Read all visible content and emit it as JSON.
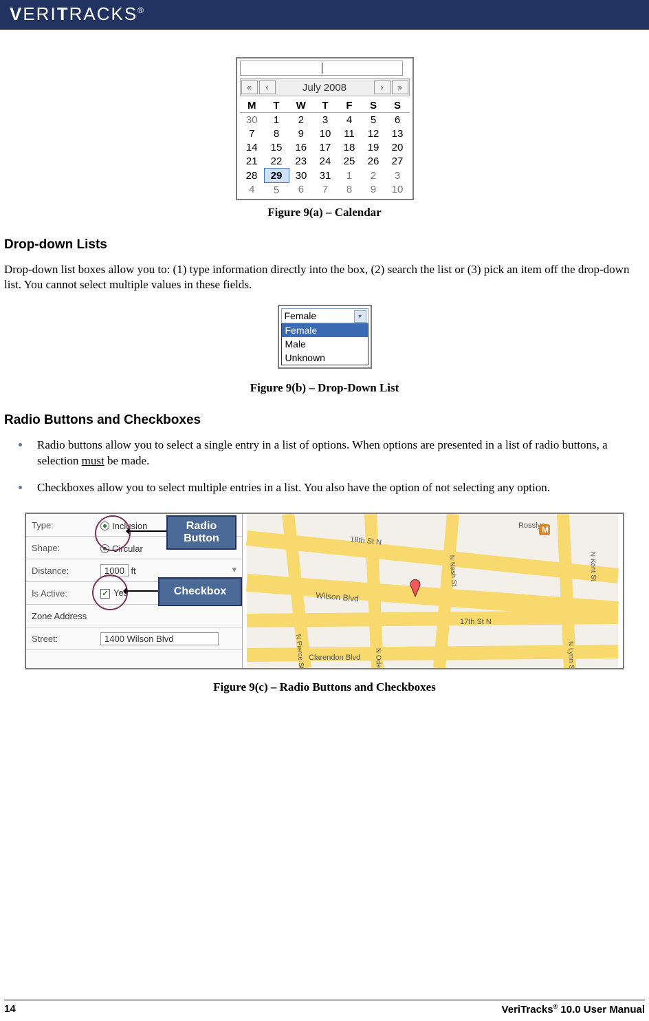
{
  "brand": "VERITRACKS",
  "regmark": "®",
  "figA_caption": "Figure 9(a) – Calendar",
  "calendar": {
    "title": "July 2008",
    "nav_first": "«",
    "nav_prev": "‹",
    "nav_next": "›",
    "nav_last": "»",
    "dow": [
      "M",
      "T",
      "W",
      "T",
      "F",
      "S",
      "S"
    ],
    "rows": [
      [
        {
          "d": "30",
          "dim": true
        },
        {
          "d": "1"
        },
        {
          "d": "2"
        },
        {
          "d": "3"
        },
        {
          "d": "4"
        },
        {
          "d": "5"
        },
        {
          "d": "6"
        }
      ],
      [
        {
          "d": "7"
        },
        {
          "d": "8"
        },
        {
          "d": "9"
        },
        {
          "d": "10"
        },
        {
          "d": "11"
        },
        {
          "d": "12"
        },
        {
          "d": "13"
        }
      ],
      [
        {
          "d": "14"
        },
        {
          "d": "15"
        },
        {
          "d": "16"
        },
        {
          "d": "17"
        },
        {
          "d": "18"
        },
        {
          "d": "19"
        },
        {
          "d": "20"
        }
      ],
      [
        {
          "d": "21"
        },
        {
          "d": "22"
        },
        {
          "d": "23"
        },
        {
          "d": "24"
        },
        {
          "d": "25"
        },
        {
          "d": "26"
        },
        {
          "d": "27"
        }
      ],
      [
        {
          "d": "28"
        },
        {
          "d": "29",
          "sel": true
        },
        {
          "d": "30"
        },
        {
          "d": "31"
        },
        {
          "d": "1",
          "dim": true
        },
        {
          "d": "2",
          "dim": true
        },
        {
          "d": "3",
          "dim": true
        }
      ],
      [
        {
          "d": "4",
          "dim": true
        },
        {
          "d": "5",
          "dim": true
        },
        {
          "d": "6",
          "dim": true
        },
        {
          "d": "7",
          "dim": true
        },
        {
          "d": "8",
          "dim": true
        },
        {
          "d": "9",
          "dim": true
        },
        {
          "d": "10",
          "dim": true
        }
      ]
    ]
  },
  "sec1_heading": "Drop-down Lists",
  "sec1_para": "Drop-down list boxes allow you to: (1) type information directly into the box, (2) search the list or (3) pick an item off the drop-down list. You cannot select multiple values in these fields.",
  "dropdown": {
    "value": "Female",
    "options": [
      "Female",
      "Male",
      "Unknown"
    ]
  },
  "figB_caption": "Figure 9(b) – Drop-Down List",
  "sec2_heading": "Radio Buttons and Checkboxes",
  "bullet1_a": "Radio buttons allow you to select a single entry in a list of options. When options are presented in a list of radio buttons, a selection ",
  "bullet1_u": "must",
  "bullet1_b": " be made.",
  "bullet2": "Checkboxes allow you to select multiple entries in a list. You also have the option of not selecting any option.",
  "form": {
    "labels": {
      "type": "Type:",
      "shape": "Shape:",
      "distance": "Distance:",
      "isactive": "Is Active:",
      "zone": "Zone Address",
      "street": "Street:"
    },
    "type_inclusion": "Inclusion",
    "shape_circular": "Circular",
    "distance_val": "1000",
    "distance_unit": "ft",
    "isactive_yes": "Yes",
    "street_val": "1400 Wilson Blvd"
  },
  "callout_radio": "Radio Button",
  "callout_checkbox": "Checkbox",
  "map_labels": {
    "wilson": "Wilson Blvd",
    "m17": "17th St N",
    "m18": "18th St N",
    "clarendon": "Clarendon Blvd",
    "nash": "N Nash St",
    "ode": "N Ode St",
    "pierce": "N Pierce St",
    "kent": "N Kent St",
    "lynn": "N Lynn St",
    "rosslyn": "Rosslyn",
    "metro": "M"
  },
  "figC_caption": "Figure 9(c) – Radio Buttons and Checkboxes",
  "footer_page": "14",
  "footer_right_a": "VeriTracks",
  "footer_right_b": " 10.0 User Manual"
}
